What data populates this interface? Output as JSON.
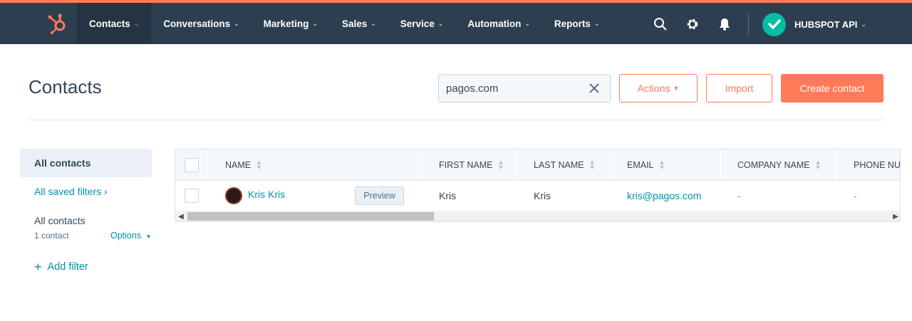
{
  "colors": {
    "accent": "#ff7a59",
    "nav_bg": "#2d3e50",
    "link": "#0091ae"
  },
  "nav": {
    "logo_icon": "hubspot-sprocket-icon",
    "items": [
      {
        "label": "Contacts"
      },
      {
        "label": "Conversations"
      },
      {
        "label": "Marketing"
      },
      {
        "label": "Sales"
      },
      {
        "label": "Service"
      },
      {
        "label": "Automation"
      },
      {
        "label": "Reports"
      }
    ],
    "icons": [
      "search-icon",
      "gear-icon",
      "bell-icon"
    ],
    "account_name": "HUBSPOT API"
  },
  "header": {
    "title": "Contacts",
    "search_value": "pagos.com",
    "actions_label": "Actions",
    "import_label": "Import",
    "create_label": "Create contact"
  },
  "sidebar": {
    "all_contacts": "All contacts",
    "saved_filters": "All saved filters",
    "view_name": "All contacts",
    "view_count": "1 contact",
    "options_label": "Options",
    "add_filter": "Add filter"
  },
  "table": {
    "columns": [
      "NAME",
      "FIRST NAME",
      "LAST NAME",
      "EMAIL",
      "COMPANY NAME",
      "PHONE NUMBER"
    ],
    "rows": [
      {
        "name": "Kris Kris",
        "preview_label": "Preview",
        "first_name": "Kris",
        "last_name": "Kris",
        "email": "kris@pagos.com",
        "company": "-",
        "phone": "-"
      }
    ]
  }
}
